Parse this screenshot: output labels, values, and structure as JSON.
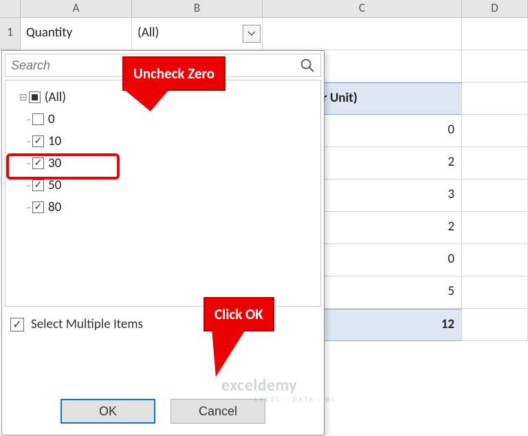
{
  "columns": [
    "A",
    "B",
    "C",
    "D"
  ],
  "rowNumbers": [
    "1"
  ],
  "filterRow": {
    "label": "Quantity",
    "value": "(All)"
  },
  "pivot": {
    "headerC": "f Price (Per Unit)",
    "values": [
      "0",
      "2",
      "3",
      "2",
      "0",
      "5"
    ],
    "total": "12"
  },
  "popup": {
    "searchPlaceholder": "Search",
    "items": [
      {
        "label": "(All)",
        "state": "indet",
        "level": "root"
      },
      {
        "label": "0",
        "state": "unchecked",
        "level": "child"
      },
      {
        "label": "10",
        "state": "checked",
        "level": "child"
      },
      {
        "label": "30",
        "state": "checked",
        "level": "child"
      },
      {
        "label": "50",
        "state": "checked",
        "level": "child"
      },
      {
        "label": "80",
        "state": "checked",
        "level": "child"
      }
    ],
    "selectMultiple": "Select Multiple Items",
    "ok": "OK",
    "cancel": "Cancel"
  },
  "callouts": {
    "uncheck": "Uncheck Zero",
    "clickok": "Click OK"
  },
  "watermark": {
    "main": "exceldemy",
    "sub": "EXCEL · DATA · BI"
  }
}
